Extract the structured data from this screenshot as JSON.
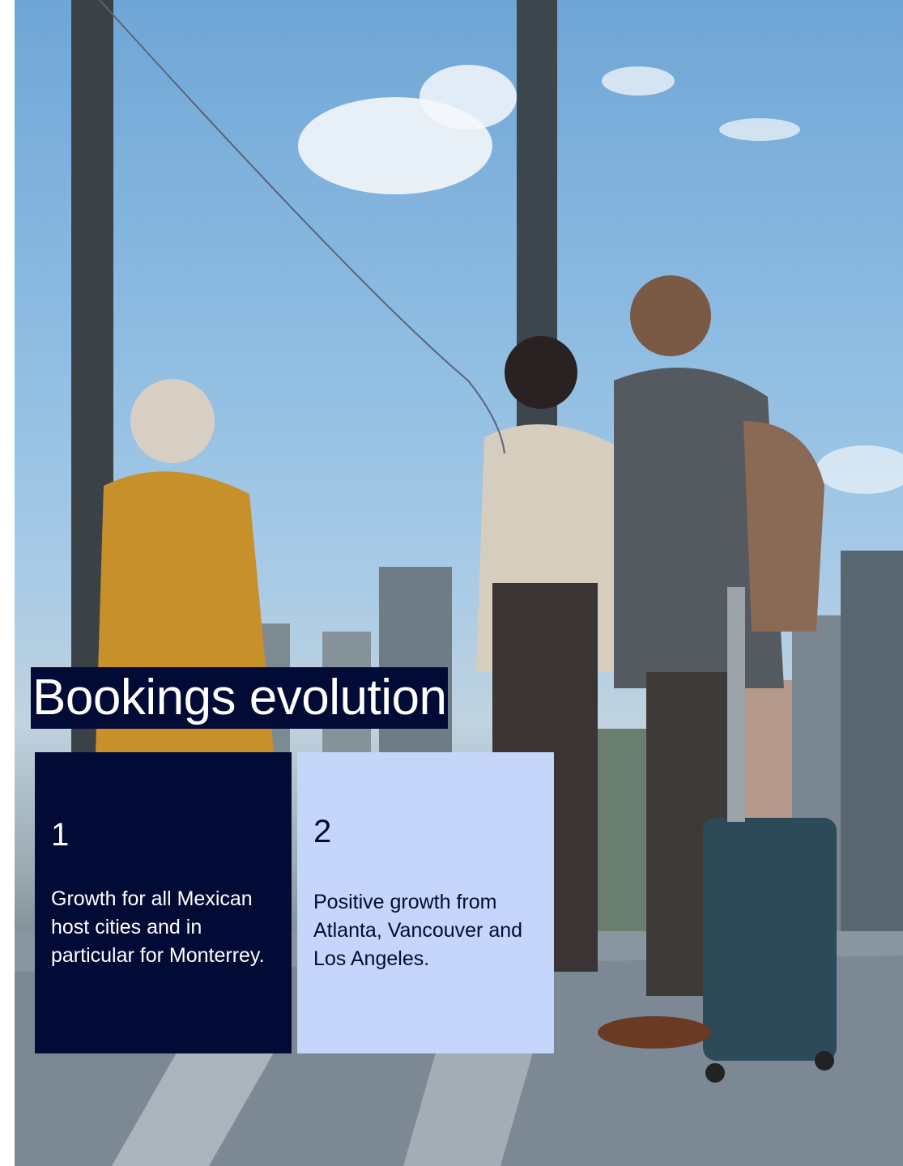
{
  "page": {
    "title": "Bookings evolution"
  },
  "cards": [
    {
      "number": "1",
      "text": "Growth for all Mexican host cities and in particular for Monterrey."
    },
    {
      "number": "2",
      "text": "Positive growth from Atlanta, Vancouver and Los Angeles."
    }
  ],
  "colors": {
    "navy": "#020b35",
    "light_blue": "#c6d6fb",
    "white": "#ffffff"
  }
}
